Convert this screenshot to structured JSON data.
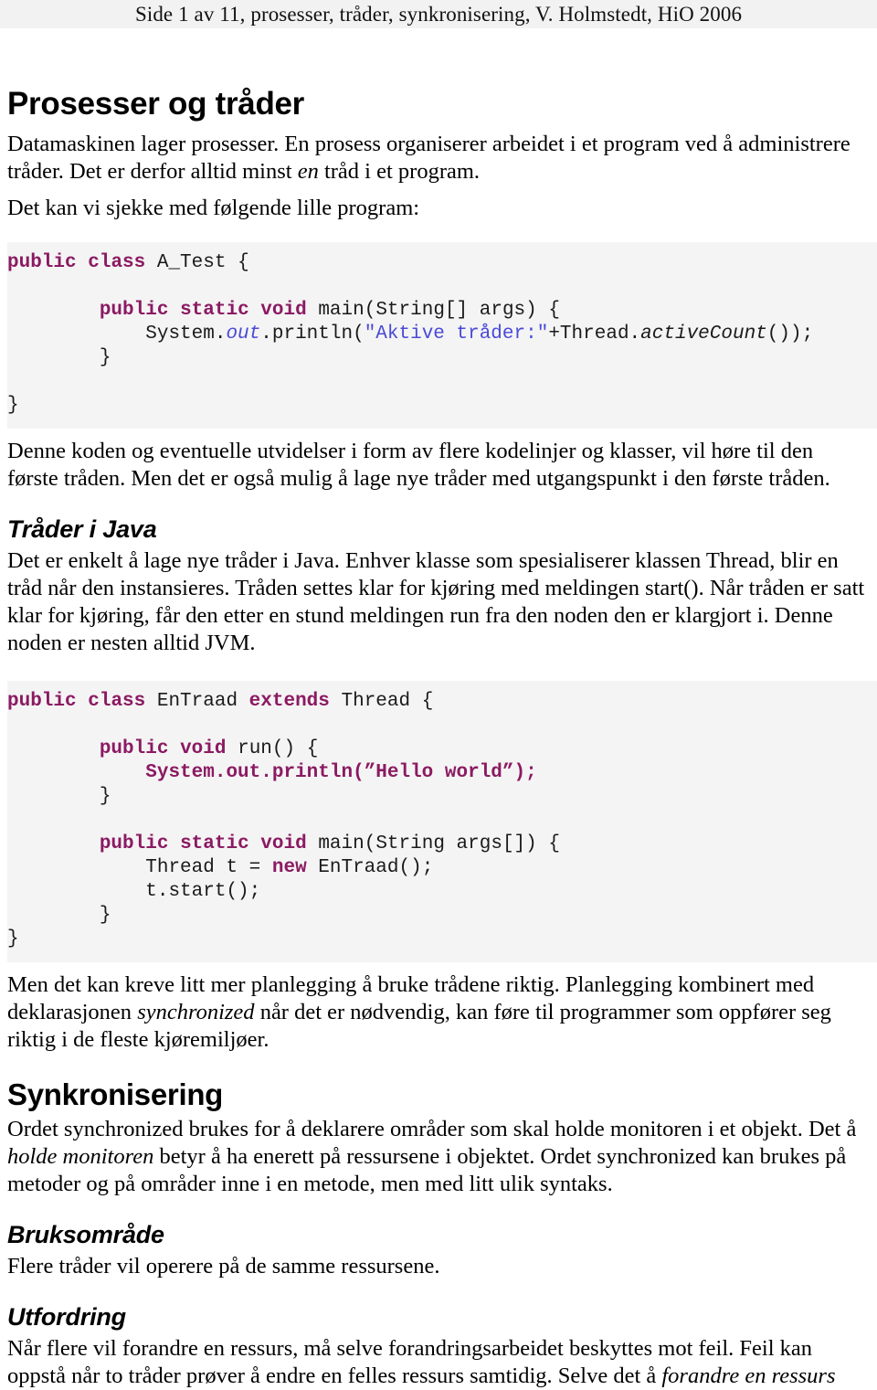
{
  "document": {
    "header": {
      "running_head": "Side 1 av 11, prosesser, tråder, synkronisering, V. Holmstedt, HiO 2006",
      "band_color": "#f2f2f2"
    },
    "title": "Prosesser og tråder",
    "intro_paragraph_part1": "Datamaskinen lager prosesser. En prosess organiserer arbeidet i et program ved å administrere tråder. Det er derfor alltid minst ",
    "intro_paragraph_emphasis": "en",
    "intro_paragraph_part2": " tråd i et program.",
    "lead_in_code1": "Det kan vi sjekke med følgende lille program:",
    "code_block_1": {
      "language": "java",
      "keyword_color": "#8B1A62",
      "string_color": "#4a4ad8",
      "background": "#f4f4f4",
      "lines": [
        {
          "tokens": [
            {
              "t": "public",
              "c": "kw"
            },
            {
              "t": " ",
              "c": "plain"
            },
            {
              "t": "class",
              "c": "kw"
            },
            {
              "t": " A_Test {",
              "c": "plain"
            }
          ]
        },
        {
          "tokens": []
        },
        {
          "tokens": [
            {
              "t": "        ",
              "c": "plain"
            },
            {
              "t": "public",
              "c": "kw"
            },
            {
              "t": " ",
              "c": "plain"
            },
            {
              "t": "static",
              "c": "kw"
            },
            {
              "t": " ",
              "c": "plain"
            },
            {
              "t": "void",
              "c": "kw"
            },
            {
              "t": " main(String[] args) {",
              "c": "plain"
            }
          ]
        },
        {
          "tokens": [
            {
              "t": "            System.",
              "c": "plain"
            },
            {
              "t": "out",
              "c": "mem"
            },
            {
              "t": ".println(",
              "c": "plain"
            },
            {
              "t": "\"Aktive tråder:\"",
              "c": "str"
            },
            {
              "t": "+Thread.",
              "c": "plain"
            },
            {
              "t": "activeCount",
              "c": "memi"
            },
            {
              "t": "());",
              "c": "plain"
            }
          ]
        },
        {
          "tokens": [
            {
              "t": "        }",
              "c": "plain"
            }
          ]
        },
        {
          "tokens": []
        },
        {
          "tokens": [
            {
              "t": "}",
              "c": "plain"
            }
          ]
        }
      ],
      "plain_text": "public class A_Test {\n\n        public static void main(String[] args) {\n            System.out.println(\"Aktive tråder:\"+Thread.activeCount());\n        }\n\n}"
    },
    "paragraph_after_code1": "Denne koden og eventuelle utvidelser i form av flere kodelinjer og klasser, vil høre til den første tråden. Men det er også mulig å lage nye tråder med utgangspunkt i den første tråden.",
    "section_trader_i_java": {
      "heading": "Tråder i Java",
      "paragraph": "Det er enkelt å lage nye tråder i Java. Enhver klasse som spesialiserer klassen Thread, blir en tråd når den instansieres. Tråden settes klar for kjøring med meldingen start(). Når tråden er satt klar for kjøring, får den etter en stund meldingen run fra den noden den er klargjort i. Denne noden er nesten alltid JVM."
    },
    "code_block_2": {
      "language": "java",
      "keyword_color": "#8B1A62",
      "background": "#f4f4f4",
      "lines": [
        {
          "tokens": [
            {
              "t": "public",
              "c": "kw"
            },
            {
              "t": " ",
              "c": "plain"
            },
            {
              "t": "class",
              "c": "kw"
            },
            {
              "t": " EnTraad ",
              "c": "plain"
            },
            {
              "t": "extends",
              "c": "kw"
            },
            {
              "t": " Thread {",
              "c": "plain"
            }
          ]
        },
        {
          "tokens": []
        },
        {
          "tokens": [
            {
              "t": "        ",
              "c": "plain"
            },
            {
              "t": "public",
              "c": "kw"
            },
            {
              "t": " ",
              "c": "plain"
            },
            {
              "t": "void",
              "c": "kw"
            },
            {
              "t": " run() {",
              "c": "plain"
            }
          ]
        },
        {
          "tokens": [
            {
              "t": "            ",
              "c": "plain"
            },
            {
              "t": "System.out.println(”Hello world”);",
              "c": "bold-maroon"
            }
          ]
        },
        {
          "tokens": [
            {
              "t": "        }",
              "c": "plain"
            }
          ]
        },
        {
          "tokens": []
        },
        {
          "tokens": [
            {
              "t": "        ",
              "c": "plain"
            },
            {
              "t": "public",
              "c": "kw"
            },
            {
              "t": " ",
              "c": "plain"
            },
            {
              "t": "static",
              "c": "kw"
            },
            {
              "t": " ",
              "c": "plain"
            },
            {
              "t": "void",
              "c": "kw"
            },
            {
              "t": " main(String args[]) {",
              "c": "plain"
            }
          ]
        },
        {
          "tokens": [
            {
              "t": "            Thread t = ",
              "c": "plain"
            },
            {
              "t": "new",
              "c": "kw"
            },
            {
              "t": " EnTraad();",
              "c": "plain"
            }
          ]
        },
        {
          "tokens": [
            {
              "t": "            t.start();",
              "c": "plain"
            }
          ]
        },
        {
          "tokens": [
            {
              "t": "        }",
              "c": "plain"
            }
          ]
        },
        {
          "tokens": [
            {
              "t": "}",
              "c": "plain"
            }
          ]
        }
      ],
      "plain_text": "public class EnTraad extends Thread {\n\n        public void run() {\n            System.out.println(”Hello world”);\n        }\n\n        public static void main(String args[]) {\n            Thread t = new EnTraad();\n            t.start();\n        }\n}"
    },
    "paragraph_after_code2_part1": "Men det kan kreve litt mer planlegging å bruke trådene riktig. Planlegging kombinert med deklarasjonen ",
    "paragraph_after_code2_emphasis": "synchronized",
    "paragraph_after_code2_part2": " når det er nødvendig, kan føre til programmer som oppfører seg riktig i de fleste kjøremiljøer.",
    "section_synkronisering": {
      "heading": "Synkronisering",
      "paragraph_part1": "Ordet synchronized brukes for å deklarere områder som skal holde monitoren i et objekt. Det å ",
      "paragraph_emphasis": "holde monitoren",
      "paragraph_part2": " betyr å ha enerett på ressursene i objektet. Ordet synchronized kan brukes på metoder og på områder inne i en metode, men med litt ulik syntaks."
    },
    "section_bruksomrade": {
      "heading": "Bruksområde",
      "paragraph": "Flere tråder vil operere på de samme ressursene."
    },
    "section_utfordring": {
      "heading": "Utfordring",
      "paragraph_part1": "Når flere vil forandre en ressurs, må selve forandringsarbeidet beskyttes mot feil. Feil kan oppstå når to tråder prøver å endre en felles ressurs samtidig. Selve det å ",
      "paragraph_emphasis": "forandre en ressurs"
    }
  }
}
